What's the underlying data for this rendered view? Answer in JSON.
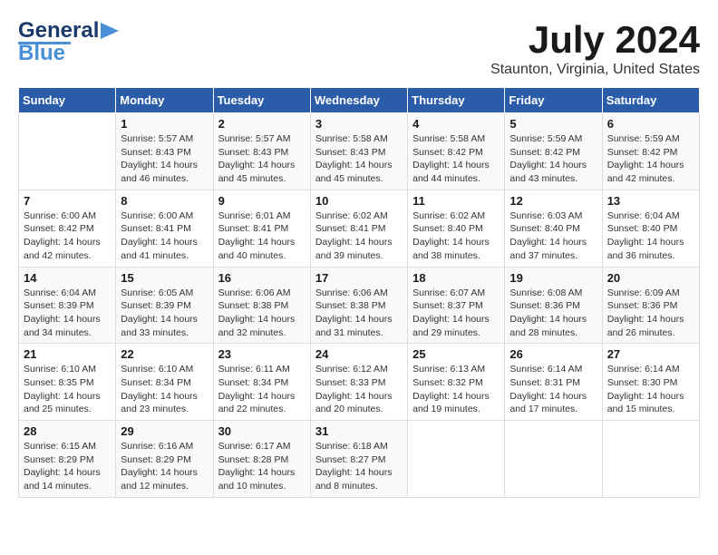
{
  "logo": {
    "line1": "General",
    "line2": "Blue"
  },
  "title": "July 2024",
  "location": "Staunton, Virginia, United States",
  "weekdays": [
    "Sunday",
    "Monday",
    "Tuesday",
    "Wednesday",
    "Thursday",
    "Friday",
    "Saturday"
  ],
  "weeks": [
    [
      {
        "day": "",
        "info": ""
      },
      {
        "day": "1",
        "info": "Sunrise: 5:57 AM\nSunset: 8:43 PM\nDaylight: 14 hours\nand 46 minutes."
      },
      {
        "day": "2",
        "info": "Sunrise: 5:57 AM\nSunset: 8:43 PM\nDaylight: 14 hours\nand 45 minutes."
      },
      {
        "day": "3",
        "info": "Sunrise: 5:58 AM\nSunset: 8:43 PM\nDaylight: 14 hours\nand 45 minutes."
      },
      {
        "day": "4",
        "info": "Sunrise: 5:58 AM\nSunset: 8:42 PM\nDaylight: 14 hours\nand 44 minutes."
      },
      {
        "day": "5",
        "info": "Sunrise: 5:59 AM\nSunset: 8:42 PM\nDaylight: 14 hours\nand 43 minutes."
      },
      {
        "day": "6",
        "info": "Sunrise: 5:59 AM\nSunset: 8:42 PM\nDaylight: 14 hours\nand 42 minutes."
      }
    ],
    [
      {
        "day": "7",
        "info": "Sunrise: 6:00 AM\nSunset: 8:42 PM\nDaylight: 14 hours\nand 42 minutes."
      },
      {
        "day": "8",
        "info": "Sunrise: 6:00 AM\nSunset: 8:41 PM\nDaylight: 14 hours\nand 41 minutes."
      },
      {
        "day": "9",
        "info": "Sunrise: 6:01 AM\nSunset: 8:41 PM\nDaylight: 14 hours\nand 40 minutes."
      },
      {
        "day": "10",
        "info": "Sunrise: 6:02 AM\nSunset: 8:41 PM\nDaylight: 14 hours\nand 39 minutes."
      },
      {
        "day": "11",
        "info": "Sunrise: 6:02 AM\nSunset: 8:40 PM\nDaylight: 14 hours\nand 38 minutes."
      },
      {
        "day": "12",
        "info": "Sunrise: 6:03 AM\nSunset: 8:40 PM\nDaylight: 14 hours\nand 37 minutes."
      },
      {
        "day": "13",
        "info": "Sunrise: 6:04 AM\nSunset: 8:40 PM\nDaylight: 14 hours\nand 36 minutes."
      }
    ],
    [
      {
        "day": "14",
        "info": "Sunrise: 6:04 AM\nSunset: 8:39 PM\nDaylight: 14 hours\nand 34 minutes."
      },
      {
        "day": "15",
        "info": "Sunrise: 6:05 AM\nSunset: 8:39 PM\nDaylight: 14 hours\nand 33 minutes."
      },
      {
        "day": "16",
        "info": "Sunrise: 6:06 AM\nSunset: 8:38 PM\nDaylight: 14 hours\nand 32 minutes."
      },
      {
        "day": "17",
        "info": "Sunrise: 6:06 AM\nSunset: 8:38 PM\nDaylight: 14 hours\nand 31 minutes."
      },
      {
        "day": "18",
        "info": "Sunrise: 6:07 AM\nSunset: 8:37 PM\nDaylight: 14 hours\nand 29 minutes."
      },
      {
        "day": "19",
        "info": "Sunrise: 6:08 AM\nSunset: 8:36 PM\nDaylight: 14 hours\nand 28 minutes."
      },
      {
        "day": "20",
        "info": "Sunrise: 6:09 AM\nSunset: 8:36 PM\nDaylight: 14 hours\nand 26 minutes."
      }
    ],
    [
      {
        "day": "21",
        "info": "Sunrise: 6:10 AM\nSunset: 8:35 PM\nDaylight: 14 hours\nand 25 minutes."
      },
      {
        "day": "22",
        "info": "Sunrise: 6:10 AM\nSunset: 8:34 PM\nDaylight: 14 hours\nand 23 minutes."
      },
      {
        "day": "23",
        "info": "Sunrise: 6:11 AM\nSunset: 8:34 PM\nDaylight: 14 hours\nand 22 minutes."
      },
      {
        "day": "24",
        "info": "Sunrise: 6:12 AM\nSunset: 8:33 PM\nDaylight: 14 hours\nand 20 minutes."
      },
      {
        "day": "25",
        "info": "Sunrise: 6:13 AM\nSunset: 8:32 PM\nDaylight: 14 hours\nand 19 minutes."
      },
      {
        "day": "26",
        "info": "Sunrise: 6:14 AM\nSunset: 8:31 PM\nDaylight: 14 hours\nand 17 minutes."
      },
      {
        "day": "27",
        "info": "Sunrise: 6:14 AM\nSunset: 8:30 PM\nDaylight: 14 hours\nand 15 minutes."
      }
    ],
    [
      {
        "day": "28",
        "info": "Sunrise: 6:15 AM\nSunset: 8:29 PM\nDaylight: 14 hours\nand 14 minutes."
      },
      {
        "day": "29",
        "info": "Sunrise: 6:16 AM\nSunset: 8:29 PM\nDaylight: 14 hours\nand 12 minutes."
      },
      {
        "day": "30",
        "info": "Sunrise: 6:17 AM\nSunset: 8:28 PM\nDaylight: 14 hours\nand 10 minutes."
      },
      {
        "day": "31",
        "info": "Sunrise: 6:18 AM\nSunset: 8:27 PM\nDaylight: 14 hours\nand 8 minutes."
      },
      {
        "day": "",
        "info": ""
      },
      {
        "day": "",
        "info": ""
      },
      {
        "day": "",
        "info": ""
      }
    ]
  ]
}
